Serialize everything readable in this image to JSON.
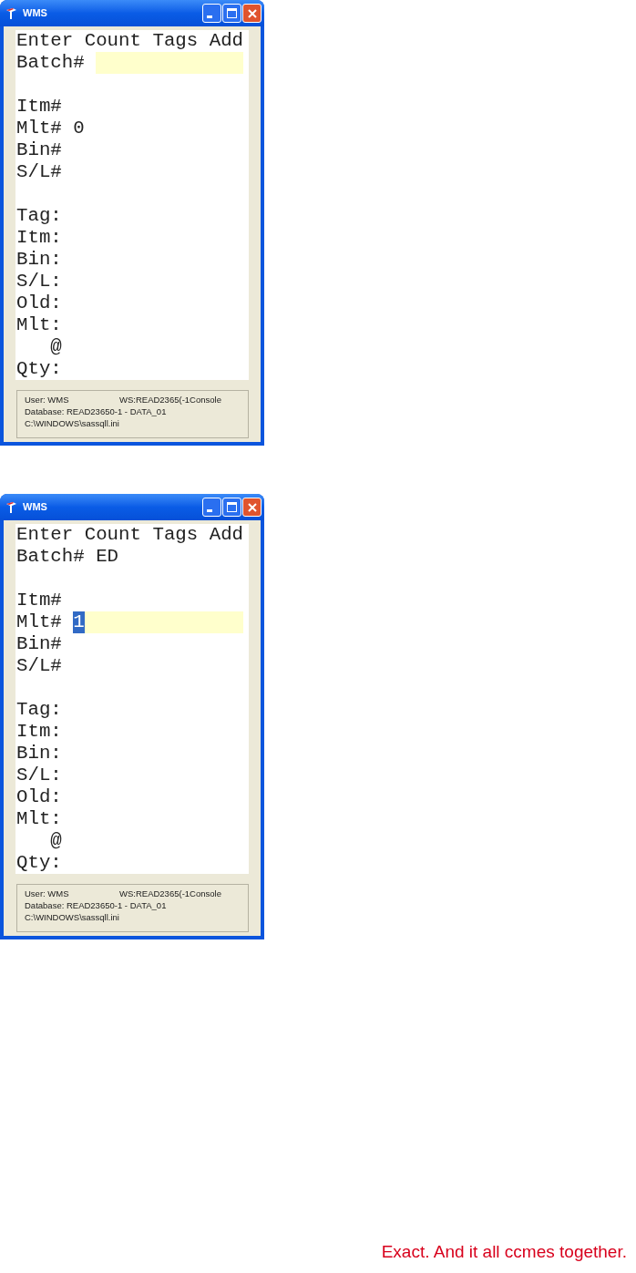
{
  "windows": [
    {
      "title": "WMS",
      "screen": {
        "heading": "Enter Count Tags Add",
        "sections": [
          {
            "lines": [
              {
                "label": "Batch#",
                "focused": true,
                "indented": false
              }
            ]
          },
          {
            "lines": [
              {
                "label": "Itm#",
                "focused": false,
                "indented": false
              },
              {
                "label": "Mlt#",
                "value": "0",
                "focused": false,
                "indented": false
              },
              {
                "label": "Bin#",
                "focused": false,
                "indented": false
              },
              {
                "label": "S/L#",
                "focused": false,
                "indented": false
              }
            ]
          },
          {
            "lines": [
              {
                "label": "Tag:",
                "focused": false,
                "indented": false
              },
              {
                "label": "Itm:",
                "focused": false,
                "indented": false
              },
              {
                "label": "Bin:",
                "focused": false,
                "indented": false
              },
              {
                "label": "S/L:",
                "focused": false,
                "indented": false
              },
              {
                "label": "Old:",
                "focused": false,
                "indented": false
              },
              {
                "label": "Mlt:",
                "focused": false,
                "indented": false
              },
              {
                "label": "@",
                "focused": false,
                "indented": true
              },
              {
                "label": "Qty:",
                "focused": false,
                "indented": false
              }
            ]
          }
        ]
      },
      "status": {
        "user": "User: WMS",
        "workstation": "WS:READ2365(-1Console",
        "database": "Database: READ23650-1 - DATA_01",
        "ini_path": "C:\\WINDOWS\\sassqll.ini"
      }
    },
    {
      "title": "WMS",
      "screen": {
        "heading": "Enter Count Tags Add",
        "sections": [
          {
            "lines": [
              {
                "label": "Batch#",
                "value": "ED",
                "focused": false,
                "indented": false
              }
            ]
          },
          {
            "lines": [
              {
                "label": "Itm#",
                "focused": false,
                "indented": false
              },
              {
                "label": "Mlt#",
                "value": "1",
                "focused": true,
                "text_selected": true,
                "indented": false
              },
              {
                "label": "Bin#",
                "focused": false,
                "indented": false
              },
              {
                "label": "S/L#",
                "focused": false,
                "indented": false
              }
            ]
          },
          {
            "lines": [
              {
                "label": "Tag:",
                "focused": false,
                "indented": false
              },
              {
                "label": "Itm:",
                "focused": false,
                "indented": false
              },
              {
                "label": "Bin:",
                "focused": false,
                "indented": false
              },
              {
                "label": "S/L:",
                "focused": false,
                "indented": false
              },
              {
                "label": "Old:",
                "focused": false,
                "indented": false
              },
              {
                "label": "Mlt:",
                "focused": false,
                "indented": false
              },
              {
                "label": "@",
                "focused": false,
                "indented": true
              },
              {
                "label": "Qty:",
                "focused": false,
                "indented": false
              }
            ]
          }
        ]
      },
      "status": {
        "user": "User: WMS",
        "workstation": "WS:READ2365(-1Console",
        "database": "Database: READ23650-1 - DATA_01",
        "ini_path": "C:\\WINDOWS\\sassqll.ini"
      }
    }
  ],
  "tagline": "Exact. And it all ccmes together."
}
